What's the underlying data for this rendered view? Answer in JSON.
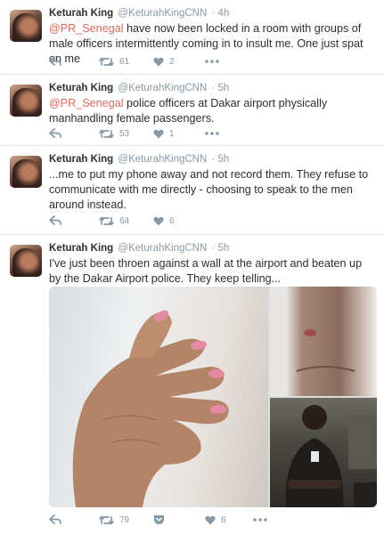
{
  "tweets": [
    {
      "author": "Keturah King",
      "handle": "@KeturahKingCNN",
      "time": "· 4h",
      "mention": "@PR_Senegal",
      "text": " have now been locked in a room with groups of male officers intermittently coming in to insult me. One just spat on me",
      "retweets": "61",
      "likes": "2"
    },
    {
      "author": "Keturah King",
      "handle": "@KeturahKingCNN",
      "time": "· 5h",
      "mention": "@PR_Senegal",
      "text": " police officers at Dakar airport physically manhandling female passengers.",
      "retweets": "53",
      "likes": "1"
    },
    {
      "author": "Keturah King",
      "handle": "@KeturahKingCNN",
      "time": "· 5h",
      "text": "...me to put my phone away and not record them. They refuse to communicate with me directly - choosing to speak to the men around instead.",
      "retweets": "64",
      "likes": "6"
    },
    {
      "author": "Keturah King",
      "handle": "@KeturahKingCNN",
      "time": "· 5h",
      "text": "I've just been throen against a wall at the airport and beaten up by the Dakar Airport police. They keep telling...",
      "retweets": "79",
      "likes": "6"
    }
  ],
  "colors": {
    "mention": "#e0695a",
    "muted": "#8899a6",
    "text": "#292f33",
    "divider": "#e1e8ed"
  },
  "icons": {
    "reply": "reply-arrow-icon",
    "retweet": "retweet-icon",
    "like": "heart-icon",
    "more": "more-dots-icon",
    "save": "pocket-save-icon"
  }
}
